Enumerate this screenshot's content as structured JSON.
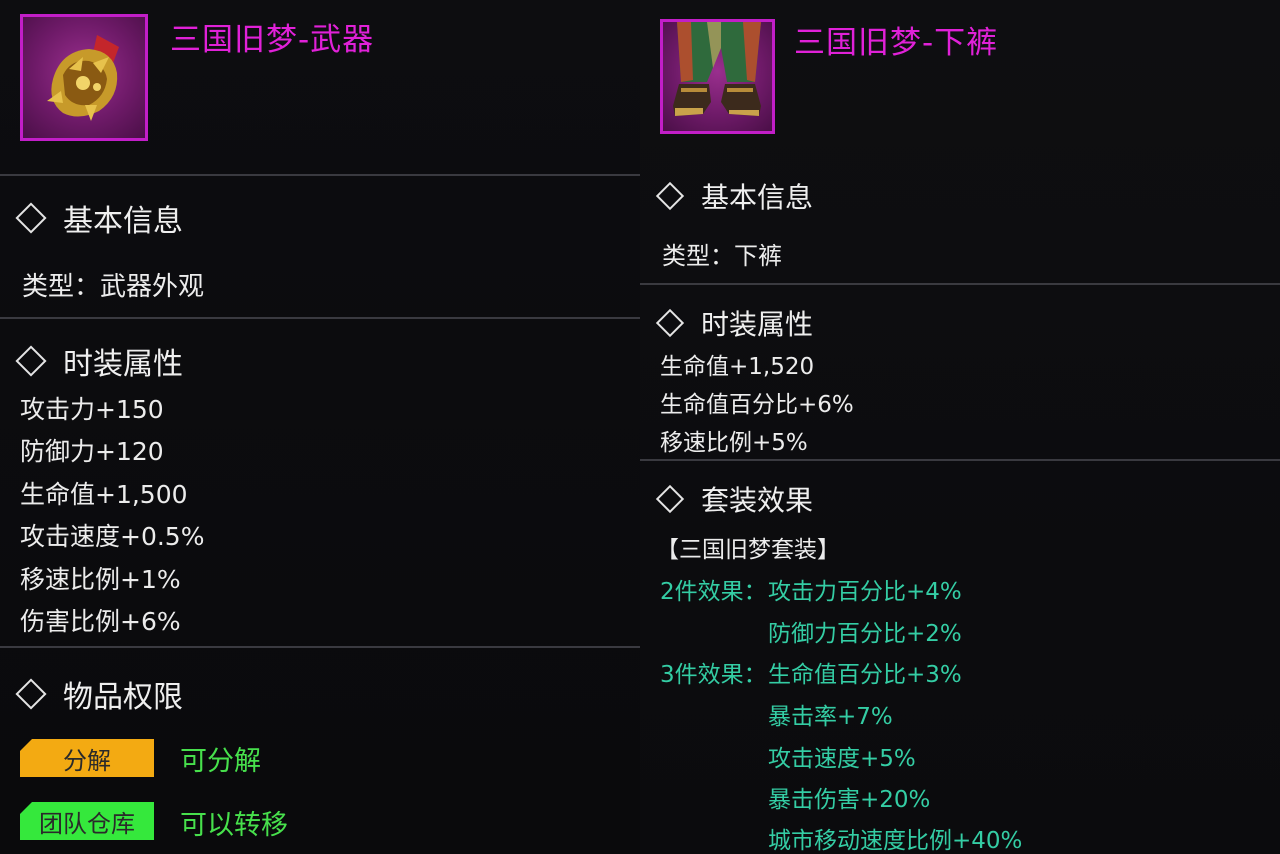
{
  "left": {
    "title": "三国旧梦-武器",
    "icon": "weapon-gauntlet-icon",
    "basic_info": {
      "heading": "基本信息",
      "type_label": "类型：",
      "type_value": "武器外观"
    },
    "attributes": {
      "heading": "时装属性",
      "items": [
        "攻击力+150",
        "防御力+120",
        "生命值+1,500",
        "攻击速度+0.5%",
        "移速比例+1%",
        "伤害比例+6%"
      ]
    },
    "permissions": {
      "heading": "物品权限",
      "rows": [
        {
          "tag": "分解",
          "tag_color": "#f3aa12",
          "value": "可分解"
        },
        {
          "tag": "团队仓库",
          "tag_color": "#35e83c",
          "value": "可以转移"
        }
      ]
    }
  },
  "right": {
    "title": "三国旧梦-下裤",
    "icon": "pants-boots-icon",
    "basic_info": {
      "heading": "基本信息",
      "type_label": "类型：",
      "type_value": "下裤"
    },
    "attributes": {
      "heading": "时装属性",
      "items": [
        "生命值+1,520",
        "生命值百分比+6%",
        "移速比例+5%"
      ]
    },
    "set_effect": {
      "heading": "套装效果",
      "set_name": "【三国旧梦套装】",
      "tiers": [
        {
          "label": "2件效果：",
          "effects": [
            "攻击力百分比+4%",
            "防御力百分比+2%"
          ]
        },
        {
          "label": "3件效果：",
          "effects": [
            "生命值百分比+3%",
            "暴击率+7%",
            "攻击速度+5%",
            "暴击伤害+20%",
            "城市移动速度比例+40%"
          ]
        }
      ]
    }
  },
  "colors": {
    "title": "#e021d8",
    "icon_border": "#c21ec8",
    "set_effect": "#34cda4",
    "permission_value": "#47e04c"
  }
}
